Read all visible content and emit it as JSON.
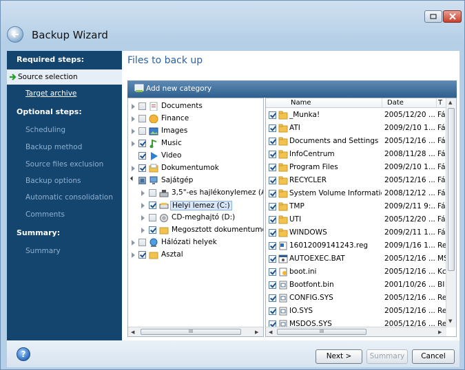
{
  "window": {
    "title": "Backup Wizard"
  },
  "sidebar": {
    "items": [
      {
        "label": "Required steps:",
        "kind": "head"
      },
      {
        "label": "Source selection",
        "kind": "active"
      },
      {
        "label": "Target archive",
        "kind": "link"
      },
      {
        "label": "Optional steps:",
        "kind": "head"
      },
      {
        "label": "Scheduling",
        "kind": "muted"
      },
      {
        "label": "Backup method",
        "kind": "muted"
      },
      {
        "label": "Source files exclusion",
        "kind": "muted"
      },
      {
        "label": "Backup options",
        "kind": "muted"
      },
      {
        "label": "Automatic consolidation",
        "kind": "muted"
      },
      {
        "label": "Comments",
        "kind": "muted"
      },
      {
        "label": "Summary:",
        "kind": "head"
      },
      {
        "label": "Summary",
        "kind": "muted"
      }
    ]
  },
  "main": {
    "title": "Files to back up",
    "toolbar_label": "Add new category"
  },
  "tree": [
    {
      "label": "Documents",
      "state": "off"
    },
    {
      "label": "Finance",
      "state": "off"
    },
    {
      "label": "Images",
      "state": "off"
    },
    {
      "label": "Music",
      "state": "on"
    },
    {
      "label": "Video",
      "state": "on"
    },
    {
      "label": "Dokumentumok",
      "state": "on"
    },
    {
      "label": "Sajátgép",
      "state": "part"
    },
    {
      "label": "3,5\"-es hajlékonylemez (A:)",
      "state": "off"
    },
    {
      "label": "Helyi lemez (C:)",
      "state": "on"
    },
    {
      "label": "CD-meghajtó (D:)",
      "state": "off"
    },
    {
      "label": "Megosztott dokumentumok",
      "state": "on"
    },
    {
      "label": "Hálózati helyek",
      "state": "off"
    },
    {
      "label": "Asztal",
      "state": "on"
    }
  ],
  "list": {
    "columns": {
      "name": "Name",
      "date": "Date",
      "type": "T"
    },
    "rows": [
      {
        "name": "_Munka!",
        "date": "2005/12/20 ...",
        "type": "Fá",
        "icon": "folder"
      },
      {
        "name": "ATI",
        "date": "2009/2/10 1...",
        "type": "Fá",
        "icon": "folder"
      },
      {
        "name": "Documents and Settings",
        "date": "2005/12/16 ...",
        "type": "Fá",
        "icon": "folder"
      },
      {
        "name": "InfoCentrum",
        "date": "2008/11/28 ...",
        "type": "Fá",
        "icon": "folder"
      },
      {
        "name": "Program Files",
        "date": "2009/2/10 1...",
        "type": "Fá",
        "icon": "folder"
      },
      {
        "name": "RECYCLER",
        "date": "2005/12/16 ...",
        "type": "Fá",
        "icon": "folder"
      },
      {
        "name": "System Volume Information",
        "date": "2008/12/12 ...",
        "type": "Fá",
        "icon": "folder"
      },
      {
        "name": "TMP",
        "date": "2009/2/11 9:...",
        "type": "Fá",
        "icon": "folder"
      },
      {
        "name": "UTI",
        "date": "2005/12/20 ...",
        "type": "Fá",
        "icon": "folder"
      },
      {
        "name": "WINDOWS",
        "date": "2009/2/11 1...",
        "type": "Fá",
        "icon": "folder"
      },
      {
        "name": "16012009141243.reg",
        "date": "2009/1/16 1...",
        "type": "Re",
        "icon": "reg"
      },
      {
        "name": "AUTOEXEC.BAT",
        "date": "2005/12/16 ...",
        "type": "MS",
        "icon": "bat"
      },
      {
        "name": "boot.ini",
        "date": "2005/12/16 ...",
        "type": "Kc",
        "icon": "ini"
      },
      {
        "name": "Bootfont.bin",
        "date": "2001/10/26 ...",
        "type": "BI",
        "icon": "sys"
      },
      {
        "name": "CONFIG.SYS",
        "date": "2005/12/16 ...",
        "type": "Re",
        "icon": "sys"
      },
      {
        "name": "IO.SYS",
        "date": "2005/12/16 ...",
        "type": "Re",
        "icon": "sys"
      },
      {
        "name": "MSDOS.SYS",
        "date": "2005/12/16 ...",
        "type": "Re",
        "icon": "sys"
      }
    ]
  },
  "scroll": {
    "thumb": "III"
  },
  "footer": {
    "help": "?",
    "next": "Next >",
    "summary": "Summary",
    "cancel": "Cancel"
  }
}
